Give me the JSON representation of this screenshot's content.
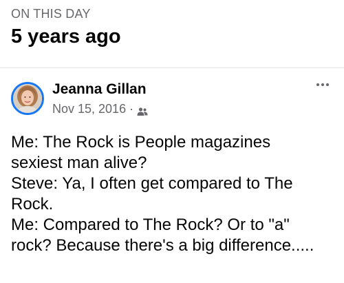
{
  "memory": {
    "label": "ON THIS DAY",
    "title": "5 years ago"
  },
  "post": {
    "author": "Jeanna Gillan",
    "date": "Nov 15, 2016",
    "separator": "·",
    "audience_icon": "friends-icon",
    "more_icon": "more-options-icon",
    "lines": [
      "Me: The Rock is People magazines",
      "sexiest man alive?",
      "Steve: Ya, I often get compared to The",
      "Rock.",
      "Me: Compared to The Rock? Or to \"a\"",
      "rock? Because there's a big difference....."
    ]
  },
  "colors": {
    "text": "#050505",
    "secondary": "#65676b",
    "avatar_ring": "#1877f2",
    "divider": "#e4e6eb"
  }
}
